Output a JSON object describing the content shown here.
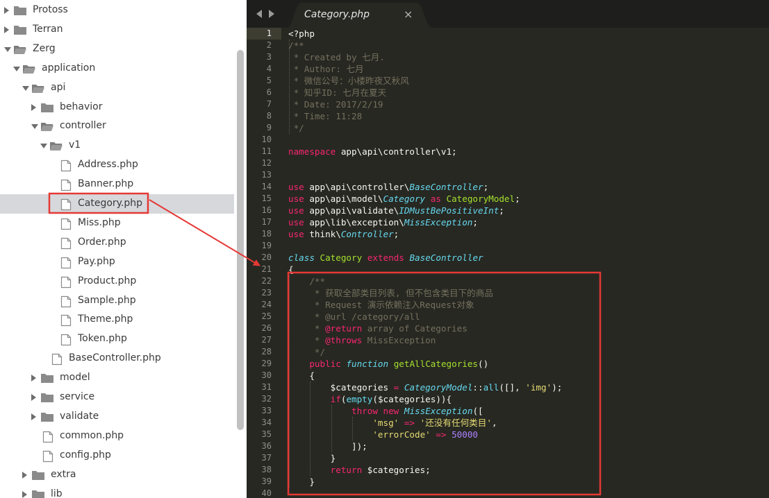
{
  "sidebar": {
    "items": [
      {
        "label": "Protoss",
        "type": "folder",
        "depth": 0,
        "expanded": false
      },
      {
        "label": "Terran",
        "type": "folder",
        "depth": 0,
        "expanded": false
      },
      {
        "label": "Zerg",
        "type": "folder",
        "depth": 0,
        "expanded": true
      },
      {
        "label": "application",
        "type": "folder",
        "depth": 1,
        "expanded": true
      },
      {
        "label": "api",
        "type": "folder",
        "depth": 2,
        "expanded": true
      },
      {
        "label": "behavior",
        "type": "folder",
        "depth": 3,
        "expanded": false
      },
      {
        "label": "controller",
        "type": "folder",
        "depth": 3,
        "expanded": true
      },
      {
        "label": "v1",
        "type": "folder",
        "depth": 4,
        "expanded": true
      },
      {
        "label": "Address.php",
        "type": "file",
        "depth": 5
      },
      {
        "label": "Banner.php",
        "type": "file",
        "depth": 5
      },
      {
        "label": "Category.php",
        "type": "file",
        "depth": 5,
        "selected": true
      },
      {
        "label": "Miss.php",
        "type": "file",
        "depth": 5
      },
      {
        "label": "Order.php",
        "type": "file",
        "depth": 5
      },
      {
        "label": "Pay.php",
        "type": "file",
        "depth": 5
      },
      {
        "label": "Product.php",
        "type": "file",
        "depth": 5
      },
      {
        "label": "Sample.php",
        "type": "file",
        "depth": 5
      },
      {
        "label": "Theme.php",
        "type": "file",
        "depth": 5
      },
      {
        "label": "Token.php",
        "type": "file",
        "depth": 5
      },
      {
        "label": "BaseController.php",
        "type": "file",
        "depth": 4
      },
      {
        "label": "model",
        "type": "folder",
        "depth": 3,
        "expanded": false
      },
      {
        "label": "service",
        "type": "folder",
        "depth": 3,
        "expanded": false
      },
      {
        "label": "validate",
        "type": "folder",
        "depth": 3,
        "expanded": false
      },
      {
        "label": "common.php",
        "type": "file",
        "depth": 3
      },
      {
        "label": "config.php",
        "type": "file",
        "depth": 3
      },
      {
        "label": "extra",
        "type": "folder",
        "depth": 2,
        "expanded": false
      },
      {
        "label": "lib",
        "type": "folder",
        "depth": 2,
        "expanded": false
      }
    ]
  },
  "editor": {
    "tab": {
      "title": "Category.php",
      "close_label": "×"
    },
    "current_line": 1,
    "lines": [
      [
        [
          "<?php",
          ""
        ]
      ],
      [
        [
          "/**",
          "cmt"
        ]
      ],
      [
        [
          " * Created by 七月.",
          "cmt"
        ]
      ],
      [
        [
          " * Author: 七月",
          "cmt"
        ]
      ],
      [
        [
          " * 微信公号：小楼昨夜又秋风",
          "cmt"
        ]
      ],
      [
        [
          " * 知乎ID: 七月在夏天",
          "cmt"
        ]
      ],
      [
        [
          " * Date: 2017/2/19",
          "cmt"
        ]
      ],
      [
        [
          " * Time: 11:28",
          "cmt"
        ]
      ],
      [
        [
          " */",
          "cmt"
        ]
      ],
      [],
      [
        [
          "namespace",
          "kw"
        ],
        [
          " app\\api\\controller\\v1;",
          ""
        ]
      ],
      [],
      [],
      [
        [
          "use",
          "kw"
        ],
        [
          " app\\api\\controller\\",
          ""
        ],
        [
          "BaseController",
          "ty"
        ],
        [
          ";",
          ""
        ]
      ],
      [
        [
          "use",
          "kw"
        ],
        [
          " app\\api\\model\\",
          ""
        ],
        [
          "Category",
          "ty"
        ],
        [
          " ",
          ""
        ],
        [
          "as",
          "kw"
        ],
        [
          " ",
          ""
        ],
        [
          "CategoryModel",
          "cls"
        ],
        [
          ";",
          ""
        ]
      ],
      [
        [
          "use",
          "kw"
        ],
        [
          " app\\api\\validate\\",
          ""
        ],
        [
          "IDMustBePositiveInt",
          "ty"
        ],
        [
          ";",
          ""
        ]
      ],
      [
        [
          "use",
          "kw"
        ],
        [
          " app\\lib\\exception\\",
          ""
        ],
        [
          "MissException",
          "ty"
        ],
        [
          ";",
          ""
        ]
      ],
      [
        [
          "use",
          "kw"
        ],
        [
          " think\\",
          ""
        ],
        [
          "Controller",
          "ty"
        ],
        [
          ";",
          ""
        ]
      ],
      [],
      [
        [
          "class",
          "ty"
        ],
        [
          " ",
          ""
        ],
        [
          "Category",
          "cls"
        ],
        [
          " ",
          ""
        ],
        [
          "extends",
          "kw"
        ],
        [
          " ",
          ""
        ],
        [
          "BaseController",
          "ty"
        ]
      ],
      [
        [
          "{",
          ""
        ]
      ],
      [
        [
          "    /**",
          "cmt"
        ]
      ],
      [
        [
          "     * 获取全部类目列表, 但不包含类目下的商品",
          "cmt"
        ]
      ],
      [
        [
          "     * Request 演示依赖注入Request对象",
          "cmt"
        ]
      ],
      [
        [
          "     * @url /category/all",
          "cmt"
        ]
      ],
      [
        [
          "     * ",
          "cmt"
        ],
        [
          "@return",
          "kw"
        ],
        [
          " array of Categories",
          "cmt"
        ]
      ],
      [
        [
          "     * ",
          "cmt"
        ],
        [
          "@throws",
          "kw"
        ],
        [
          " MissException",
          "cmt"
        ]
      ],
      [
        [
          "     */",
          "cmt"
        ]
      ],
      [
        [
          "    ",
          ""
        ],
        [
          "public",
          "kw"
        ],
        [
          " ",
          ""
        ],
        [
          "function",
          "ty"
        ],
        [
          " ",
          ""
        ],
        [
          "getAllCategories",
          "fn"
        ],
        [
          "()",
          ""
        ]
      ],
      [
        [
          "    {",
          ""
        ]
      ],
      [
        [
          "        $categories ",
          ""
        ],
        [
          "=",
          "kw"
        ],
        [
          " ",
          ""
        ],
        [
          "CategoryModel",
          "ty"
        ],
        [
          "::",
          ""
        ],
        [
          "all",
          "cf"
        ],
        [
          "([], ",
          ""
        ],
        [
          "'img'",
          "str"
        ],
        [
          ");",
          ""
        ]
      ],
      [
        [
          "        ",
          ""
        ],
        [
          "if",
          "kw"
        ],
        [
          "(",
          ""
        ],
        [
          "empty",
          "cf"
        ],
        [
          "($categories)){",
          ""
        ]
      ],
      [
        [
          "            ",
          ""
        ],
        [
          "throw",
          "kw"
        ],
        [
          " ",
          ""
        ],
        [
          "new",
          "kw"
        ],
        [
          " ",
          ""
        ],
        [
          "MissException",
          "ty"
        ],
        [
          "([",
          ""
        ]
      ],
      [
        [
          "                ",
          ""
        ],
        [
          "'msg'",
          "str"
        ],
        [
          " ",
          ""
        ],
        [
          "=>",
          "kw"
        ],
        [
          " ",
          ""
        ],
        [
          "'还没有任何类目'",
          "str"
        ],
        [
          ",",
          ""
        ]
      ],
      [
        [
          "                ",
          ""
        ],
        [
          "'errorCode'",
          "str"
        ],
        [
          " ",
          ""
        ],
        [
          "=>",
          "kw"
        ],
        [
          " ",
          ""
        ],
        [
          "50000",
          "num"
        ]
      ],
      [
        [
          "            ]);",
          ""
        ]
      ],
      [
        [
          "        }",
          ""
        ]
      ],
      [
        [
          "        ",
          ""
        ],
        [
          "return",
          "kw"
        ],
        [
          " $categories;",
          ""
        ]
      ],
      [
        [
          "    }",
          ""
        ]
      ],
      []
    ]
  },
  "colors": {
    "editor_bg": "#272822",
    "tab_bg": "#1e1f1c",
    "annotation_red": "#e53935",
    "selected_row_bg": "#d6d8dc"
  }
}
